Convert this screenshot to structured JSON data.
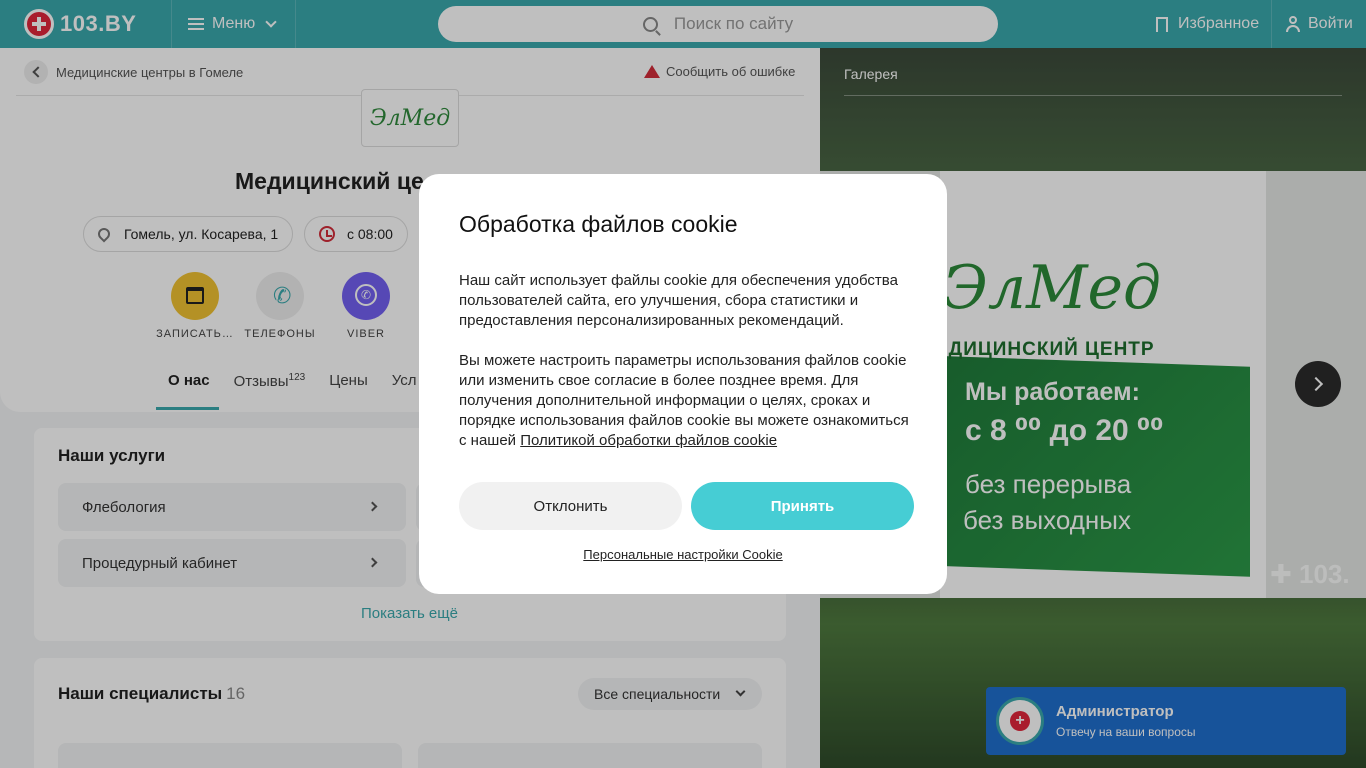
{
  "header": {
    "logo_text": "103.BY",
    "menu_label": "Меню",
    "search_placeholder": "Поиск по сайту",
    "favorites_label": "Избранное",
    "login_label": "Войти"
  },
  "breadcrumb": {
    "back_label": "Медицинские центры в Гомеле",
    "report_label": "Сообщить об ошибке"
  },
  "clinic": {
    "logo_text": "ЭлМед",
    "title": "Медицинский це",
    "address": "Гомель, ул. Косарева, 1",
    "hours": "с 08:00"
  },
  "actions": [
    {
      "label": "ЗАПИСАТЬ…",
      "icon": "calendar-icon",
      "color": "#f1c232"
    },
    {
      "label": "ТЕЛЕФОНЫ",
      "icon": "phone-icon",
      "color": "#eeeeee"
    },
    {
      "label": "VIBER",
      "icon": "viber-icon",
      "color": "#7360f2"
    }
  ],
  "tabs": [
    {
      "label": "О нас"
    },
    {
      "label": "Отзывы",
      "count": "123"
    },
    {
      "label": "Цены"
    },
    {
      "label": "Усл"
    }
  ],
  "services": {
    "heading": "Наши услуги",
    "items": [
      "Флебология",
      "Процедурный кабинет"
    ],
    "show_more": "Показать ещё"
  },
  "specialists": {
    "heading": "Наши специалисты",
    "count": "16",
    "filter_label": "Все специальности"
  },
  "gallery": {
    "label": "Галерея",
    "sign": {
      "name": "ЭлМед",
      "subtitle": "ЕДИЦИНСКИЙ ЦЕНТР",
      "line1": "Мы работаем:",
      "line2": "с 8 ⁰⁰ до 20 ⁰⁰",
      "line3": "без перерыва",
      "line4": "без выходных"
    },
    "watermark": "✚ 103."
  },
  "admin_widget": {
    "name": "Администратор",
    "subtitle": "Отвечу на ваши вопросы"
  },
  "cookie_modal": {
    "title": "Обработка файлов cookie",
    "paragraph1": "Наш сайт использует файлы cookie для обеспечения удобства пользователей сайта, его улучшения, сбора статистики и предоставления персонализированных рекомендаций.",
    "paragraph2": "Вы можете настроить параметры использования файлов cookie или изменить свое согласие в более позднее время. Для получения дополнительной информации о целях, сроках и порядке использования файлов cookie вы можете ознакомиться с нашей ",
    "policy_link": "Политикой обработки файлов cookie",
    "decline_label": "Отклонить",
    "accept_label": "Принять",
    "settings_link": "Персональные настройки Cookie"
  },
  "colors": {
    "header_bg": "#3aa8ac",
    "accent": "#46cdd4",
    "admin_bg": "#1f6fce",
    "brand_red": "#e2263b"
  }
}
